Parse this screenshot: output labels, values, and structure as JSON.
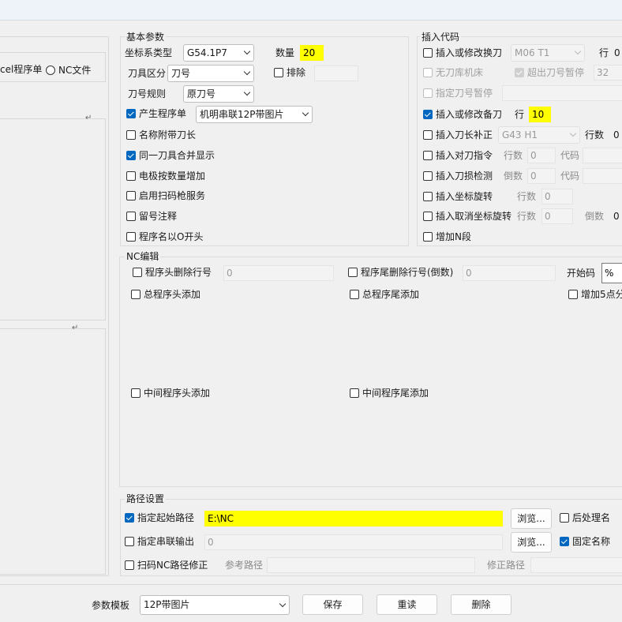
{
  "left": {
    "excel_option": "cel程序单",
    "nc_option": "NC文件"
  },
  "basic": {
    "title": "基本参数",
    "coord_label": "坐标系类型",
    "coord_value": "G54.1P7",
    "qty_label": "数量",
    "qty_value": "20",
    "tool_zone_label": "刀具区分",
    "tool_zone_value": "刀号",
    "exclude_label": "排除",
    "tool_rule_label": "刀号规则",
    "tool_rule_value": "原刀号",
    "gen_program_label": "产生程序单",
    "gen_program_value": "机明串联12P带图片",
    "name_with_length_label": "名称附带刀长",
    "merge_same_tool_label": "同一刀具合并显示",
    "electrode_qty_label": "电极按数量增加",
    "scan_gun_label": "启用扫码枪服务",
    "keep_comment_label": "留号注释",
    "name_with_o_label": "程序名以O开头"
  },
  "insert": {
    "title": "插入代码",
    "change_tool_label": "插入或修改换刀",
    "change_tool_value": "M06 T1",
    "row_label": "行",
    "row_value_1": "0",
    "no_magazine_label": "无刀库机床",
    "over_tool_label": "超出刀号暂停",
    "over_tool_value": "32",
    "pause_tool_label": "指定刀号暂停",
    "backup_tool_label": "插入或修改备刀",
    "backup_row_label": "行",
    "backup_row_value": "10",
    "length_comp_label": "插入刀长补正",
    "length_comp_value": "G43 H1",
    "lines_label": "行数",
    "lines_value": "0",
    "tool_setting_label": "插入对刀指令",
    "tool_setting_lines_label": "行数",
    "tool_setting_lines_value": "0",
    "code_label": "代码",
    "wear_check_label": "插入刀损检测",
    "reverse_label": "倒数",
    "wear_reverse_value": "0",
    "wear_code_label": "代码",
    "coord_rot_label": "插入坐标旋转",
    "coord_rot_lines_label": "行数",
    "coord_rot_lines_value": "0",
    "cancel_rot_label": "插入取消坐标旋转",
    "cancel_rot_lines_label": "行数",
    "cancel_rot_lines_value": "0",
    "cancel_rot_reverse_label": "倒数",
    "cancel_rot_reverse_value": "0",
    "add_n_label": "增加N段"
  },
  "nc_edit": {
    "title": "NC编辑",
    "head_delete_label": "程序头删除行号",
    "head_delete_value": "0",
    "tail_delete_label": "程序尾删除行号(倒数)",
    "tail_delete_value": "0",
    "start_code_label": "开始码",
    "start_code_value": "%",
    "total_head_label": "总程序头添加",
    "total_tail_label": "总程序尾添加",
    "add_5axis_label": "增加5点分",
    "mid_head_label": "中间程序头添加",
    "mid_tail_label": "中间程序尾添加"
  },
  "path": {
    "title": "路径设置",
    "start_path_label": "指定起始路径",
    "start_path_value": "E:\\NC",
    "browse_1": "浏览...",
    "post_name_label": "后处理名",
    "serial_output_label": "指定串联输出",
    "serial_output_value": "0",
    "browse_2": "浏览...",
    "fixed_name_label": "固定名称",
    "scan_fix_label": "扫码NC路径修正",
    "ref_path_label": "参考路径",
    "fix_path_label": "修正路径"
  },
  "bottom": {
    "template_label": "参数模板",
    "template_value": "12P带图片",
    "save": "保存",
    "reload": "重读",
    "delete": "删除"
  }
}
